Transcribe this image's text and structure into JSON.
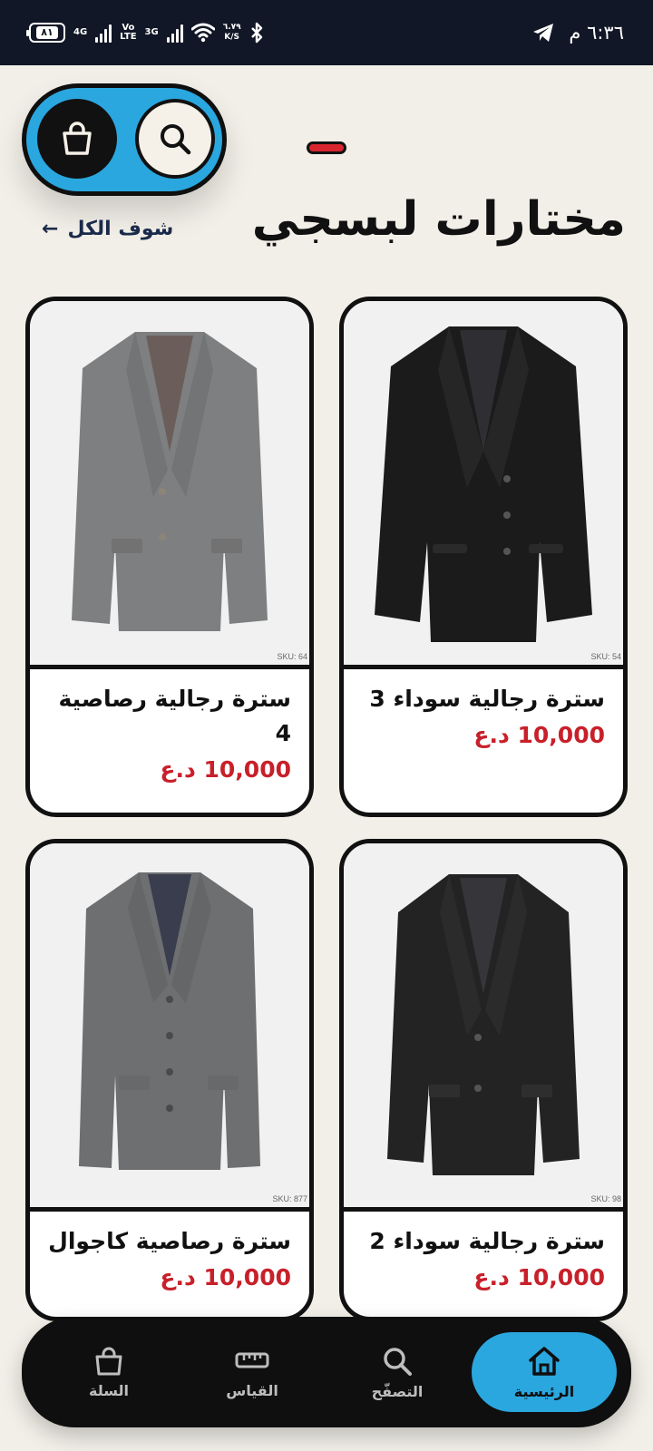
{
  "status_bar": {
    "time": "٦:٣٦ م",
    "battery": "٨١",
    "network1": "4G",
    "volte": "Vo\nLTE",
    "network2": "3G",
    "speed_value": "٦.٧٩",
    "speed_unit": "K/S"
  },
  "header": {
    "title": "مختارات لبسجي",
    "see_all": "شوف الكل",
    "see_all_arrow": "←"
  },
  "products": [
    {
      "name": "سترة رجالية سوداء 3",
      "price": "10,000 د.ع",
      "sku": "SKU: 54",
      "color": "#1b1b1b",
      "style": "black-3"
    },
    {
      "name": "سترة رجالية رصاصية 4",
      "price": "10,000 د.ع",
      "sku": "SKU: 64",
      "color": "#7e7f80",
      "style": "grey-4"
    },
    {
      "name": "سترة رجالية سوداء 2",
      "price": "10,000 د.ع",
      "sku": "SKU: 98",
      "color": "#232323",
      "style": "black-2"
    },
    {
      "name": "سترة رصاصية كاجوال",
      "price": "10,000 د.ع",
      "sku": "SKU: 877",
      "color": "#6e6f71",
      "style": "grey-casual"
    }
  ],
  "bottom_nav": {
    "home": "الرئيسية",
    "browse": "التصفّح",
    "measure": "القياس",
    "cart": "السلة"
  },
  "colors": {
    "accent": "#2aa7df",
    "price": "#c8202a",
    "background": "#f2efe8"
  }
}
